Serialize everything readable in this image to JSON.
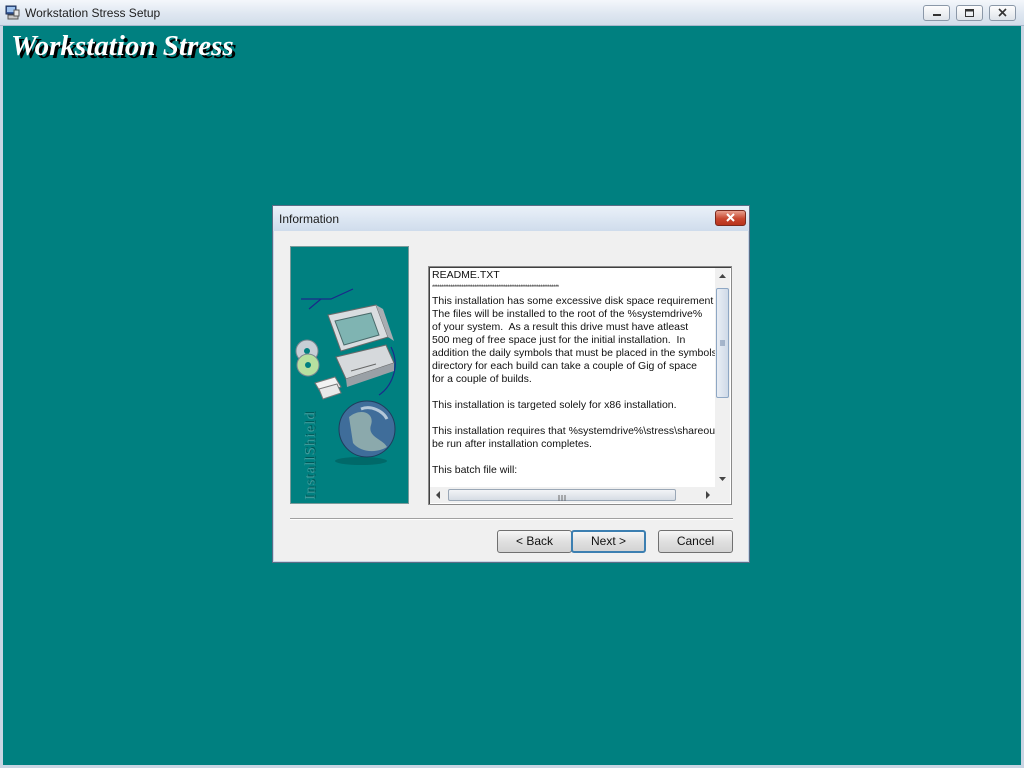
{
  "window": {
    "title": "Workstation Stress Setup",
    "icon": "installer-icon",
    "controls": [
      "minimize-icon",
      "restore-icon",
      "close-icon"
    ]
  },
  "banner": {
    "text": "Workstation Stress"
  },
  "dialog": {
    "title": "Information",
    "side_art_text": "InstallShield",
    "readme_lines": [
      "README.TXT",
      "*********************************************************************",
      "This installation has some excessive disk space requirement",
      "The files will be installed to the root of the %systemdrive%",
      "of your system.  As a result this drive must have atleast",
      "500 meg of free space just for the initial installation.  In",
      "addition the daily symbols that must be placed in the symbols",
      "directory for each build can take a couple of Gig of space",
      "for a couple of builds.",
      "",
      "This installation is targeted solely for x86 installation.",
      "",
      "This installation requires that %systemdrive%\\stress\\shareou",
      "be run after installation completes.",
      "",
      "This batch file will:"
    ],
    "buttons": {
      "back": "< Back",
      "next": "Next >",
      "cancel": "Cancel"
    }
  },
  "colors": {
    "desktop": "#008080",
    "banner_text": "#ffffff",
    "banner_shadow": "#000000",
    "default_button_border": "#3c7fb1"
  }
}
